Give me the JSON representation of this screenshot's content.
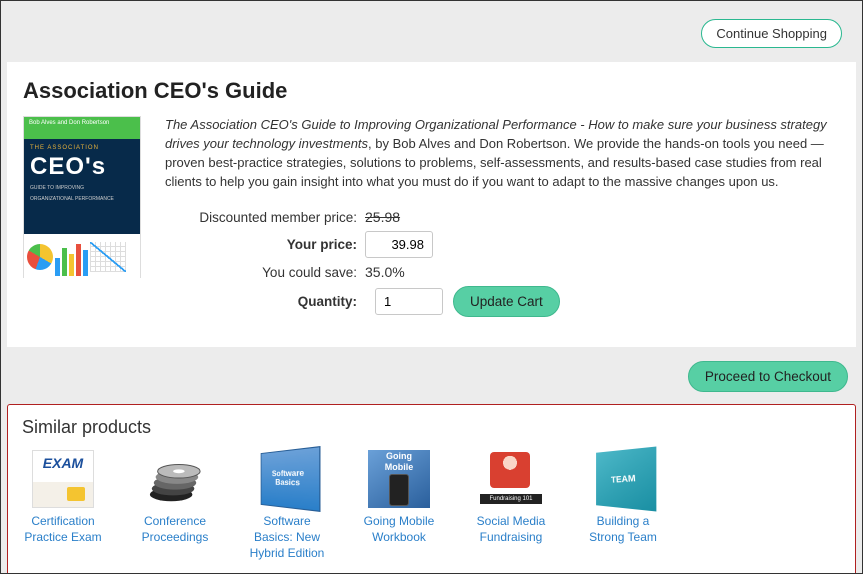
{
  "topbar": {
    "continue_label": "Continue Shopping"
  },
  "product": {
    "title": "Association CEO's Guide",
    "cover_author_line": "Bob Alves and Don Robertson",
    "cover_small_title": "THE ASSOCIATION",
    "cover_big": "CEO's",
    "cover_sub1": "GUIDE TO IMPROVING",
    "cover_sub2": "ORGANIZATIONAL PERFORMANCE",
    "desc_italic": "The Association CEO's Guide to Improving Organizational Performance - How to make sure your business strategy drives your technology investments",
    "desc_rest": ", by Bob Alves and Don Robertson. We provide the hands-on tools you need — proven best-practice strategies, solutions to problems, self-assessments, and results-based case studies from real clients to help you gain insight into what you must do if you want to adapt to the massive changes upon us."
  },
  "pricing": {
    "discount_label": "Discounted member price:",
    "discount_value": "25.98",
    "your_price_label": "Your price:",
    "your_price_value": "39.98",
    "save_label": "You could save:",
    "save_value": "35.0%",
    "quantity_label": "Quantity:",
    "quantity_value": "1",
    "update_label": "Update Cart"
  },
  "checkout": {
    "proceed_label": "Proceed to Checkout"
  },
  "similar": {
    "heading": "Similar products",
    "items": [
      {
        "label": "Certification Practice Exam"
      },
      {
        "label": "Conference Proceedings"
      },
      {
        "label": "Software Basics: New Hybrid Edition"
      },
      {
        "label": "Going Mobile Workbook"
      },
      {
        "label": "Social Media Fundraising"
      },
      {
        "label": "Building a Strong Team"
      }
    ],
    "soft_line1": "Software",
    "soft_line2": "Basics",
    "mobile_line1": "Going",
    "mobile_line2": "Mobile",
    "team_text": "TEAM"
  }
}
